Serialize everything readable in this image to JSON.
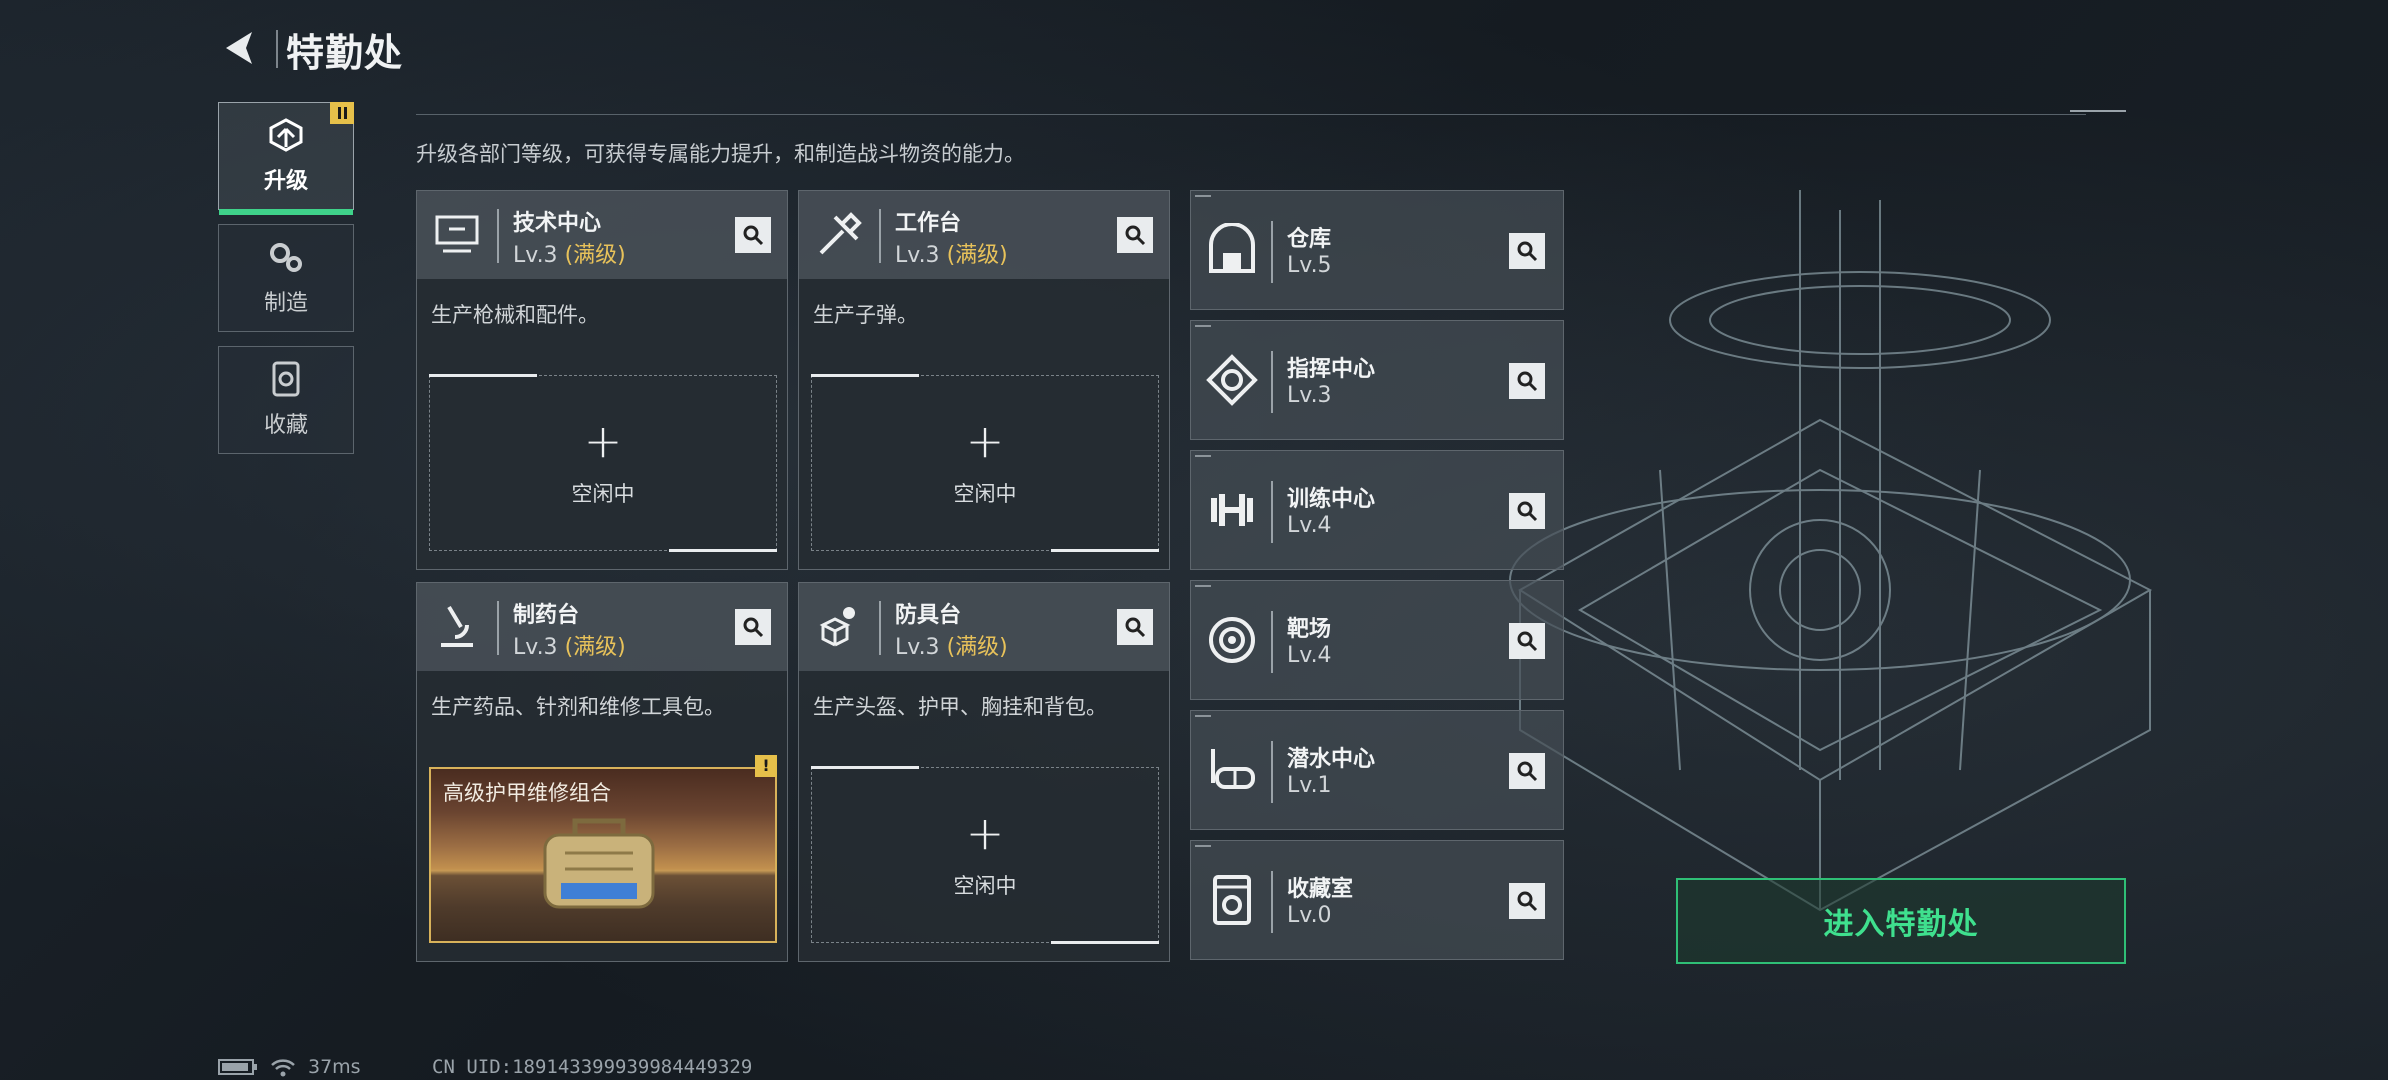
{
  "header": {
    "title": "特勤处"
  },
  "tabs": [
    {
      "label": "升级",
      "icon": "upgrade-icon",
      "active": true
    },
    {
      "label": "制造",
      "icon": "gears-icon",
      "active": false
    },
    {
      "label": "收藏",
      "icon": "collection-icon",
      "active": false
    }
  ],
  "description": "升级各部门等级，可获得专属能力提升，和制造战斗物资的能力。",
  "cards": [
    {
      "name": "技术中心",
      "level": "Lv.3",
      "max_label": "(满级)",
      "desc": "生产枪械和配件。",
      "slot_label": "空闲中",
      "slot_plus": "+",
      "icon": "computer-icon"
    },
    {
      "name": "工作台",
      "level": "Lv.3",
      "max_label": "(满级)",
      "desc": "生产子弹。",
      "slot_label": "空闲中",
      "slot_plus": "+",
      "icon": "tools-icon"
    },
    {
      "name": "制药台",
      "level": "Lv.3",
      "max_label": "(满级)",
      "desc": "生产药品、针剂和维修工具包。",
      "product_name": "高级护甲维修组合",
      "warn": "!",
      "icon": "microscope-icon"
    },
    {
      "name": "防具台",
      "level": "Lv.3",
      "max_label": "(满级)",
      "desc": "生产头盔、护甲、胸挂和背包。",
      "slot_label": "空闲中",
      "slot_plus": "+",
      "icon": "armor-icon"
    }
  ],
  "facilities": [
    {
      "name": "仓库",
      "level": "Lv.5",
      "icon": "warehouse-icon"
    },
    {
      "name": "指挥中心",
      "level": "Lv.3",
      "icon": "command-icon"
    },
    {
      "name": "训练中心",
      "level": "Lv.4",
      "icon": "dumbbell-icon"
    },
    {
      "name": "靶场",
      "level": "Lv.4",
      "icon": "target-icon"
    },
    {
      "name": "潜水中心",
      "level": "Lv.1",
      "icon": "diving-mask-icon"
    },
    {
      "name": "收藏室",
      "level": "Lv.0",
      "icon": "collection-room-icon"
    }
  ],
  "enter_button": "进入特勤处",
  "status": {
    "ping": "37ms",
    "uid": "CN UID:18914339993998444932​9"
  },
  "colors": {
    "accent": "#3fe08e",
    "gold": "#e8c25a",
    "warn": "#e6c04a"
  }
}
